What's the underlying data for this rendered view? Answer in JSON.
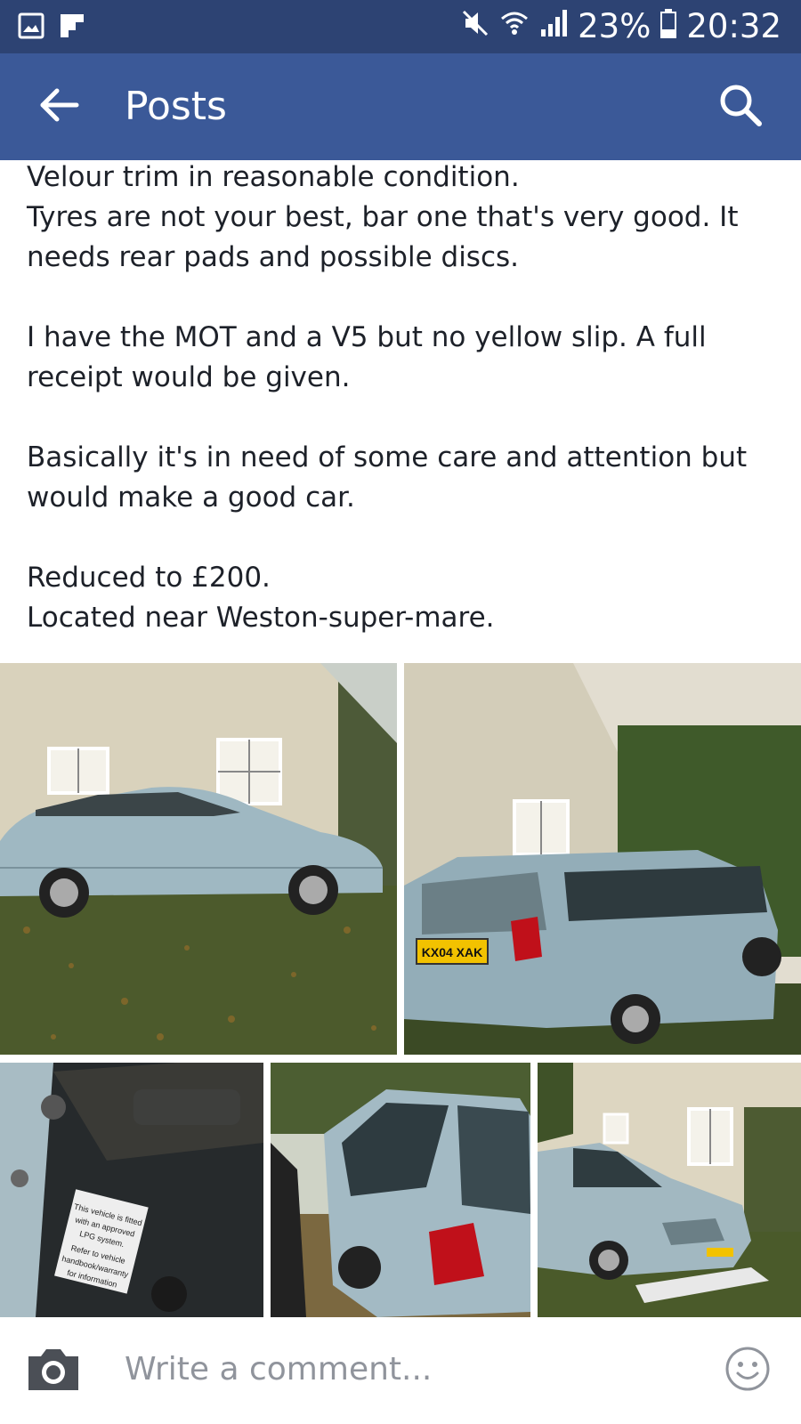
{
  "status_bar": {
    "left_icons": [
      "gallery-icon",
      "flipboard-icon"
    ],
    "right_icons": [
      "mute-icon",
      "wifi-icon",
      "signal-icon",
      "battery-icon"
    ],
    "battery_percent": "23%",
    "time": "20:32"
  },
  "app_bar": {
    "title": "Posts",
    "back_icon": "arrow-left-icon",
    "search_icon": "search-icon"
  },
  "post": {
    "paragraphs": [
      {
        "lines": [
          "Velour trim in reasonable condition.",
          "Tyres are not your best, bar one that's very good. It needs rear pads and possible discs."
        ]
      },
      {
        "lines": [
          "I have the MOT and a V5 but no yellow slip. A full receipt would be given."
        ]
      },
      {
        "lines": [
          "Basically it's in need of some care and attention but would make a good car."
        ]
      },
      {
        "lines": [
          "Reduced to £200.",
          "Located near Weston-super-mare."
        ]
      }
    ]
  },
  "photos": {
    "count": 5,
    "plate_text": "KX04 XAK",
    "sticker_text": "This vehicle is fitted with an approved LPG system. Refer to vehicle handbook/warranty for information"
  },
  "comment_bar": {
    "placeholder": "Write a comment...",
    "camera_icon": "camera-icon",
    "emoji_icon": "emoji-icon"
  },
  "colors": {
    "status_bar": "#2d4373",
    "app_bar": "#3b5998",
    "text": "#1d2129",
    "placeholder": "#90949c"
  }
}
